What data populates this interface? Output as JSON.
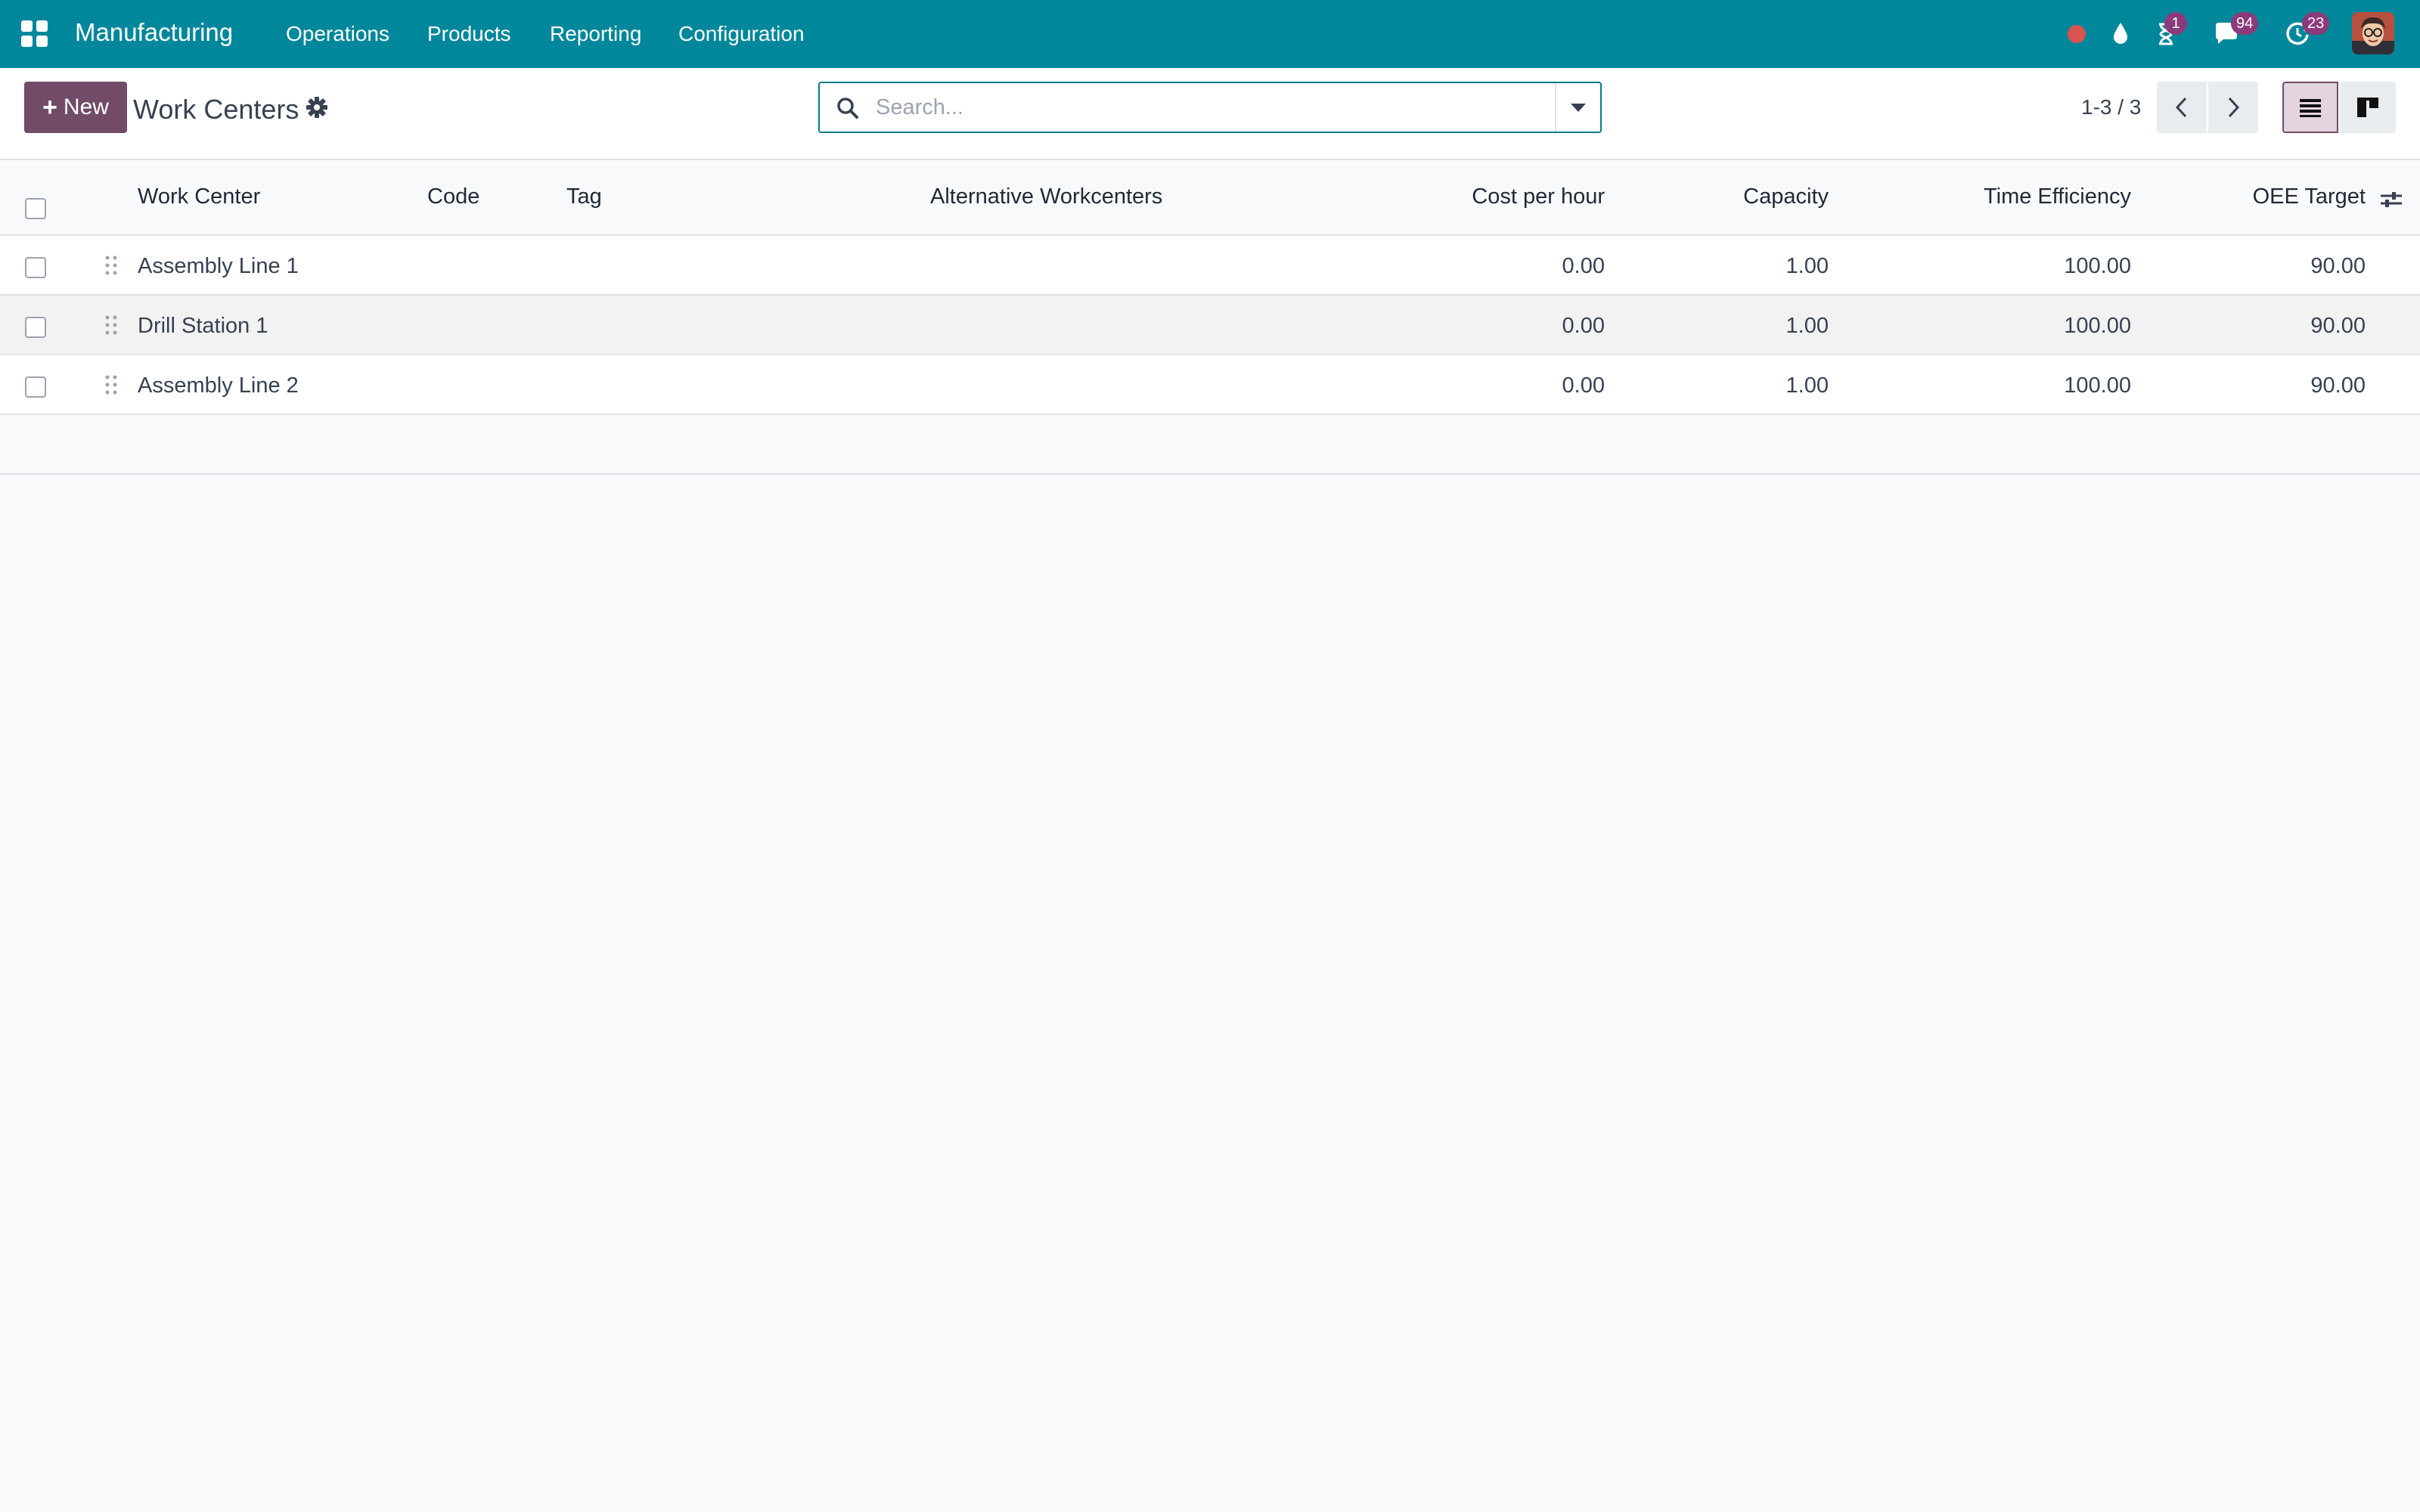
{
  "navbar": {
    "brand": "Manufacturing",
    "menu": [
      "Operations",
      "Products",
      "Reporting",
      "Configuration"
    ],
    "activity_badge": "1",
    "messages_badge": "94",
    "updates_badge": "23"
  },
  "control_panel": {
    "new_label": "New",
    "title": "Work Centers",
    "search_placeholder": "Search...",
    "pager": "1-3 / 3"
  },
  "table": {
    "headers": {
      "work_center": "Work Center",
      "code": "Code",
      "tag": "Tag",
      "alternative": "Alternative Workcenters",
      "cost": "Cost per hour",
      "capacity": "Capacity",
      "time_efficiency": "Time Efficiency",
      "oee": "OEE Target"
    },
    "rows": [
      {
        "name": "Assembly Line 1",
        "code": "",
        "tag": "",
        "alternative": "",
        "cost": "0.00",
        "capacity": "1.00",
        "time_efficiency": "100.00",
        "oee": "90.00"
      },
      {
        "name": "Drill Station 1",
        "code": "",
        "tag": "",
        "alternative": "",
        "cost": "0.00",
        "capacity": "1.00",
        "time_efficiency": "100.00",
        "oee": "90.00"
      },
      {
        "name": "Assembly Line 2",
        "code": "",
        "tag": "",
        "alternative": "",
        "cost": "0.00",
        "capacity": "1.00",
        "time_efficiency": "100.00",
        "oee": "90.00"
      }
    ]
  },
  "colors": {
    "navbar": "#00879b",
    "primary": "#714b67",
    "badge": "#8b3a7c",
    "record_dot": "#d9534f"
  },
  "icons": [
    "apps-grid-icon",
    "record-dot-icon",
    "droplet-icon",
    "hourglass-icon",
    "chat-icon",
    "refresh-clock-icon",
    "gear-icon",
    "search-icon",
    "chevron-left-icon",
    "chevron-right-icon",
    "list-view-icon",
    "kanban-view-icon",
    "drag-handle-icon",
    "optional-columns-icon"
  ]
}
